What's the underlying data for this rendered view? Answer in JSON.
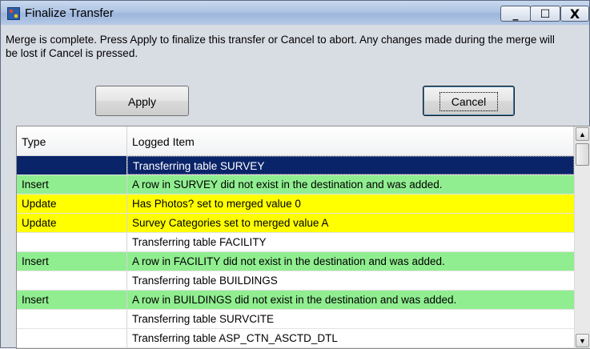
{
  "window": {
    "title": "Finalize Transfer",
    "icon": "app-icon",
    "controls": {
      "minimize": "_",
      "maximize": "☐",
      "close": "X"
    }
  },
  "message": "Merge is complete.  Press Apply to finalize this transfer or Cancel to abort.  Any changes made during the merge will be lost if Cancel is pressed.",
  "buttons": {
    "apply": "Apply",
    "cancel": "Cancel"
  },
  "log": {
    "columns": [
      "Type",
      "Logged Item"
    ],
    "rows": [
      {
        "type": "",
        "item": "Transferring table SURVEY",
        "style": "selected"
      },
      {
        "type": "Insert",
        "item": "A row in SURVEY did not exist in the destination and was added.",
        "style": "insert"
      },
      {
        "type": "Update",
        "item": "Has Photos? set to merged value 0",
        "style": "update"
      },
      {
        "type": "Update",
        "item": "Survey Categories set to merged value A",
        "style": "update"
      },
      {
        "type": "",
        "item": "Transferring table FACILITY",
        "style": "plain"
      },
      {
        "type": "Insert",
        "item": "A row in FACILITY did not exist in the destination and was added.",
        "style": "insert"
      },
      {
        "type": "",
        "item": "Transferring table BUILDINGS",
        "style": "plain"
      },
      {
        "type": "Insert",
        "item": "A row in BUILDINGS did not exist in the destination and was added.",
        "style": "insert"
      },
      {
        "type": "",
        "item": "Transferring table SURVCITE",
        "style": "plain"
      },
      {
        "type": "",
        "item": "Transferring table ASP_CTN_ASCTD_DTL",
        "style": "plain"
      }
    ]
  },
  "colors": {
    "selected_bg": "#0a246a",
    "selected_fg": "#ffffff",
    "insert_bg": "#90ee90",
    "update_bg": "#ffff00",
    "plain_bg": "#ffffff"
  }
}
